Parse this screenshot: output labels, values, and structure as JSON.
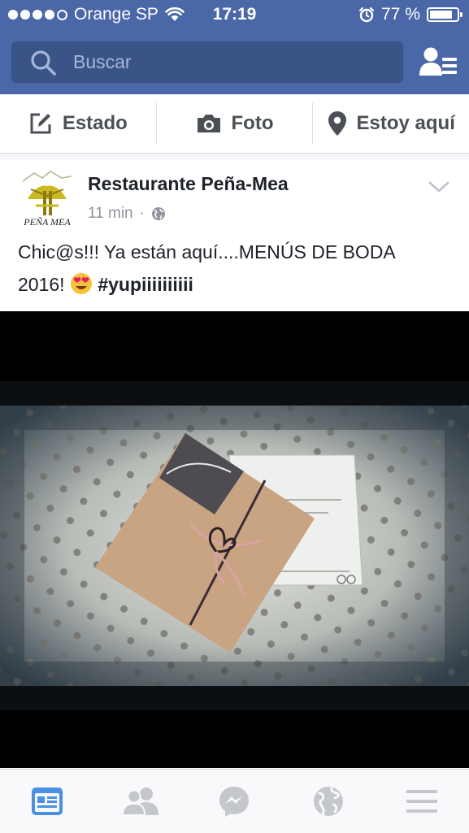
{
  "status_bar": {
    "carrier": "Orange SP",
    "time": "17:19",
    "battery": "77 %",
    "battery_level": 0.77
  },
  "search": {
    "placeholder": "Buscar",
    "icon": "search-icon"
  },
  "header_actions": {
    "friends_icon": "friend-requests-icon"
  },
  "composer": {
    "status_label": "Estado",
    "photo_label": "Foto",
    "checkin_label": "Estoy aquí"
  },
  "post": {
    "author": "Restaurante Peña-Mea",
    "time": "11 min",
    "separator": "·",
    "privacy_icon": "globe-icon",
    "logo_text": "PEÑA MEA",
    "text_line1": "Chic@s!!! Ya están aquí....MENÚS DE BODA",
    "text_line2_prefix": "2016! ",
    "emoji": "heart-eyes-emoji",
    "hashtag": "#yupiiiiiiiiii",
    "image": "wedding-menu-photo"
  },
  "tabs": [
    {
      "name": "news-feed",
      "icon": "news-feed-icon",
      "active": true
    },
    {
      "name": "friends",
      "icon": "friends-icon",
      "active": false
    },
    {
      "name": "messenger",
      "icon": "messenger-icon",
      "active": false
    },
    {
      "name": "notifications",
      "icon": "globe-icon",
      "active": false
    },
    {
      "name": "more",
      "icon": "menu-icon",
      "active": false
    }
  ],
  "colors": {
    "brand_blue": "#4a67a8",
    "search_bg": "#3b5487",
    "active_tab": "#4a90e2",
    "inactive_tab": "#c4c7cc"
  }
}
